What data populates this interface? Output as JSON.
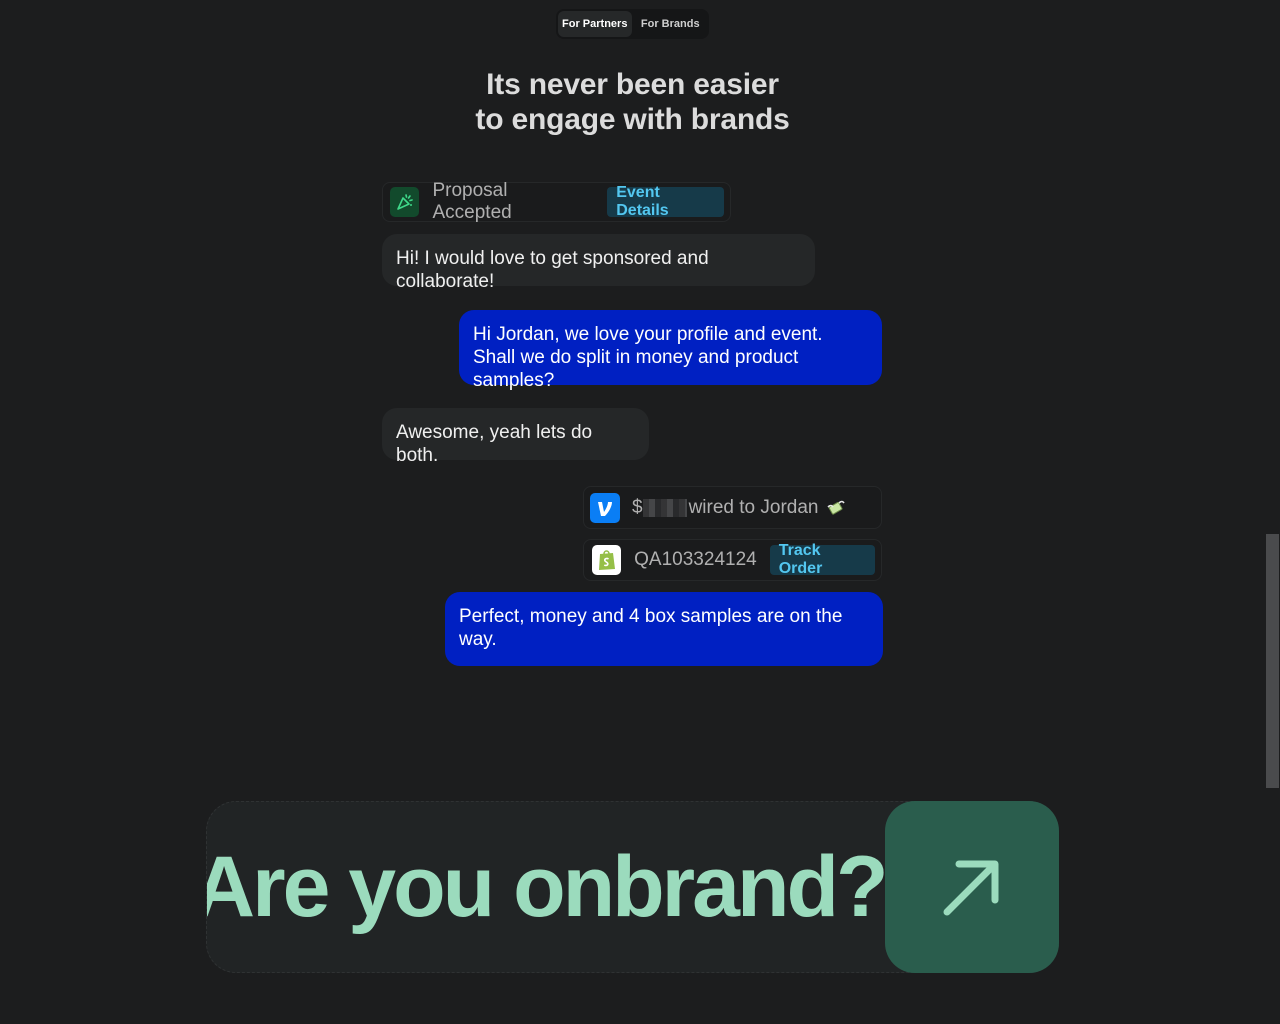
{
  "tabs": {
    "partners": "For Partners",
    "brands": "For Brands"
  },
  "heading": {
    "line1": "Its never been easier",
    "line2": "to engage with brands"
  },
  "proposal": {
    "text": "Proposal Accepted",
    "action": "Event Details",
    "icon": "party-popper-icon"
  },
  "messages": [
    {
      "from": "partner",
      "text": "Hi! I would love to get sponsored and collaborate!"
    },
    {
      "from": "brand",
      "text": "Hi Jordan, we love your profile and event. Shall we do split in money and product samples?"
    },
    {
      "from": "partner",
      "text": "Awesome, yeah lets do both."
    },
    {
      "from": "brand",
      "text": "Perfect, money and 4 box samples are on the way."
    }
  ],
  "payment": {
    "prefix": "$",
    "text": "wired to Jordan",
    "icon": "venmo-icon",
    "emoji": "money-with-wings-icon"
  },
  "order": {
    "tracking": "QA103324124",
    "action": "Track Order",
    "icon": "shopify-icon"
  },
  "cta": {
    "text": "Are you onbrand?",
    "icon": "arrow-up-right-icon"
  },
  "colors": {
    "background": "#1c1d1e",
    "brand_bubble": "#0020c2",
    "partner_bubble": "#252728",
    "cta_text": "#9bdbbd",
    "cta_button": "#2a5d4d",
    "link_accent": "#53c7f0"
  }
}
